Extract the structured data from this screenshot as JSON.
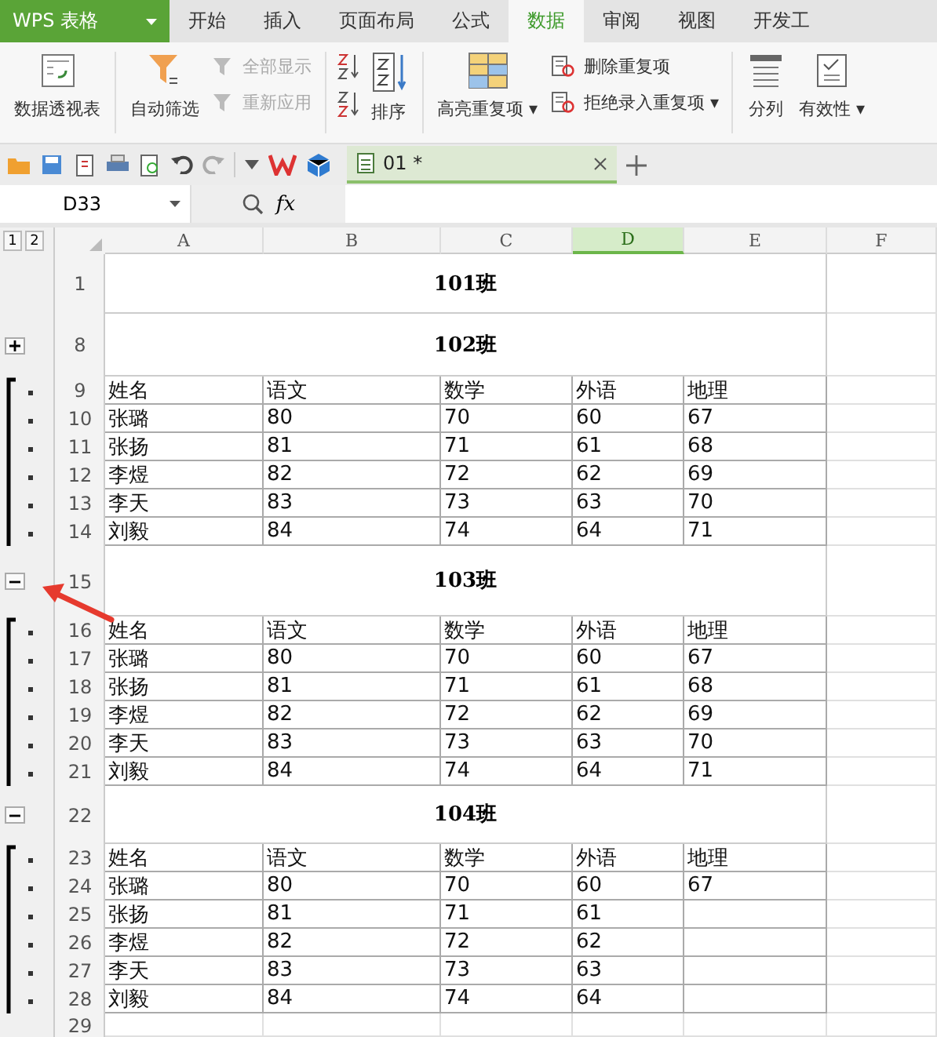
{
  "app_button": {
    "label": "WPS 表格"
  },
  "ribbon_tabs": [
    {
      "label": "开始",
      "selected": false
    },
    {
      "label": "插入",
      "selected": false
    },
    {
      "label": "页面布局",
      "selected": false
    },
    {
      "label": "公式",
      "selected": false
    },
    {
      "label": "数据",
      "selected": true
    },
    {
      "label": "审阅",
      "selected": false
    },
    {
      "label": "视图",
      "selected": false
    },
    {
      "label": "开发工",
      "selected": false
    }
  ],
  "ribbon": {
    "pivot": {
      "label": "数据透视表"
    },
    "filter": {
      "label": "自动筛选"
    },
    "filter_small": [
      {
        "label": "全部显示",
        "disabled": true
      },
      {
        "label": "重新应用",
        "disabled": true
      }
    ],
    "sort": {
      "label": "排序"
    },
    "highlight": {
      "label": "高亮重复项",
      "dropdown": "▾"
    },
    "dup_small": [
      {
        "label": "删除重复项"
      },
      {
        "label": "拒绝录入重复项",
        "dropdown": "▾"
      }
    ],
    "split": {
      "label": "分列"
    },
    "validity": {
      "label": "有效性",
      "dropdown": "▾"
    }
  },
  "doc_tab": {
    "title": "01 *"
  },
  "name_box": {
    "value": "D33"
  },
  "formula_label": "fx",
  "outline_levels": [
    "1",
    "2"
  ],
  "columns": [
    {
      "label": "A",
      "selected": false
    },
    {
      "label": "B",
      "selected": false
    },
    {
      "label": "C",
      "selected": false
    },
    {
      "label": "D",
      "selected": true
    },
    {
      "label": "E",
      "selected": false
    },
    {
      "label": "F",
      "selected": false
    }
  ],
  "rows": [
    {
      "number": "1",
      "kind": "title",
      "title": "101班",
      "grouped": false
    },
    {
      "number": "8",
      "kind": "title",
      "title": "102班",
      "grouped": false,
      "toggle": {
        "expanded": false
      }
    },
    {
      "number": "9",
      "kind": "data",
      "grouped": true,
      "cells": [
        "姓名",
        "语文",
        "数学",
        "外语",
        "地理"
      ]
    },
    {
      "number": "10",
      "kind": "data",
      "grouped": true,
      "cells": [
        "张璐",
        "80",
        "70",
        "60",
        "67"
      ]
    },
    {
      "number": "11",
      "kind": "data",
      "grouped": true,
      "cells": [
        "张扬",
        "81",
        "71",
        "61",
        "68"
      ]
    },
    {
      "number": "12",
      "kind": "data",
      "grouped": true,
      "cells": [
        "李煜",
        "82",
        "72",
        "62",
        "69"
      ]
    },
    {
      "number": "13",
      "kind": "data",
      "grouped": true,
      "cells": [
        "李天",
        "83",
        "73",
        "63",
        "70"
      ]
    },
    {
      "number": "14",
      "kind": "data",
      "grouped": true,
      "cells": [
        "刘毅",
        "84",
        "74",
        "64",
        "71"
      ]
    },
    {
      "number": "15",
      "kind": "title",
      "title": "103班",
      "grouped": false,
      "toggle": {
        "expanded": true
      }
    },
    {
      "number": "16",
      "kind": "data",
      "grouped": true,
      "cells": [
        "姓名",
        "语文",
        "数学",
        "外语",
        "地理"
      ]
    },
    {
      "number": "17",
      "kind": "data",
      "grouped": true,
      "cells": [
        "张璐",
        "80",
        "70",
        "60",
        "67"
      ]
    },
    {
      "number": "18",
      "kind": "data",
      "grouped": true,
      "cells": [
        "张扬",
        "81",
        "71",
        "61",
        "68"
      ]
    },
    {
      "number": "19",
      "kind": "data",
      "grouped": true,
      "cells": [
        "李煜",
        "82",
        "72",
        "62",
        "69"
      ]
    },
    {
      "number": "20",
      "kind": "data",
      "grouped": true,
      "cells": [
        "李天",
        "83",
        "73",
        "63",
        "70"
      ]
    },
    {
      "number": "21",
      "kind": "data",
      "grouped": true,
      "cells": [
        "刘毅",
        "84",
        "74",
        "64",
        "71"
      ]
    },
    {
      "number": "22",
      "kind": "title",
      "title": "104班",
      "grouped": false,
      "toggle": {
        "expanded": true
      }
    },
    {
      "number": "23",
      "kind": "data",
      "grouped": true,
      "cells": [
        "姓名",
        "语文",
        "数学",
        "外语",
        "地理"
      ]
    },
    {
      "number": "24",
      "kind": "data",
      "grouped": true,
      "cells": [
        "张璐",
        "80",
        "70",
        "60",
        "67"
      ]
    },
    {
      "number": "25",
      "kind": "data",
      "grouped": true,
      "cells": [
        "张扬",
        "81",
        "71",
        "61"
      ]
    },
    {
      "number": "26",
      "kind": "data",
      "grouped": true,
      "cells": [
        "李煜",
        "82",
        "72",
        "62"
      ]
    },
    {
      "number": "27",
      "kind": "data",
      "grouped": true,
      "cells": [
        "李天",
        "83",
        "73",
        "63"
      ]
    },
    {
      "number": "28",
      "kind": "data",
      "grouped": true,
      "cells": [
        "刘毅",
        "84",
        "74",
        "64"
      ]
    },
    {
      "number": "29",
      "kind": "empty",
      "grouped": false
    }
  ]
}
